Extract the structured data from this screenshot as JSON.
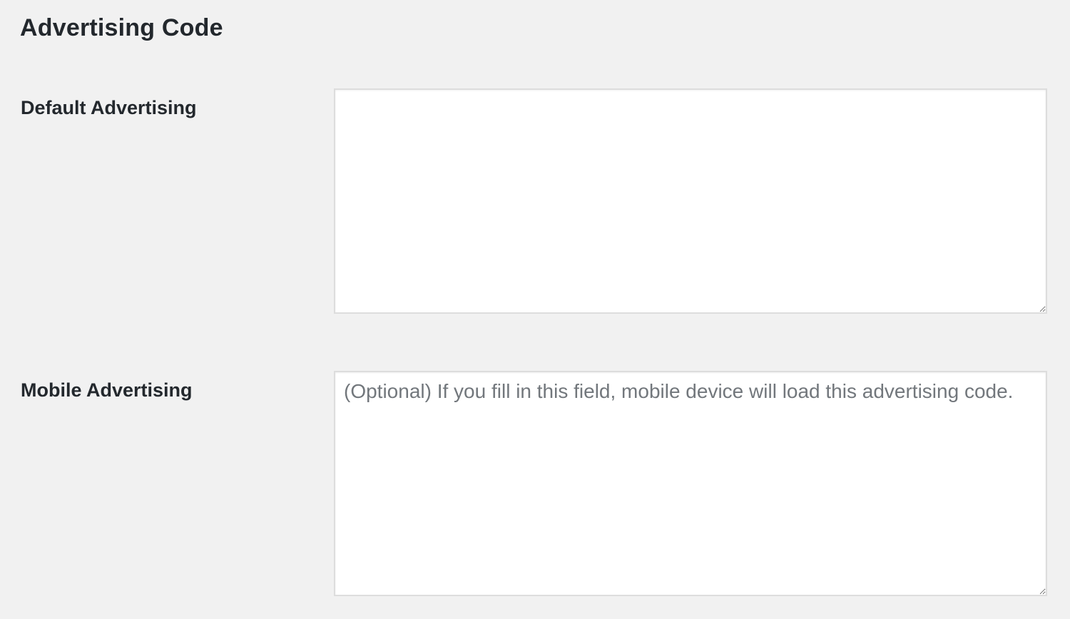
{
  "section": {
    "title": "Advertising Code"
  },
  "fields": {
    "default_advertising": {
      "label": "Default Advertising",
      "value": "",
      "placeholder": ""
    },
    "mobile_advertising": {
      "label": "Mobile Advertising",
      "value": "",
      "placeholder": "(Optional) If you fill in this field, mobile device will load this advertising code."
    }
  }
}
